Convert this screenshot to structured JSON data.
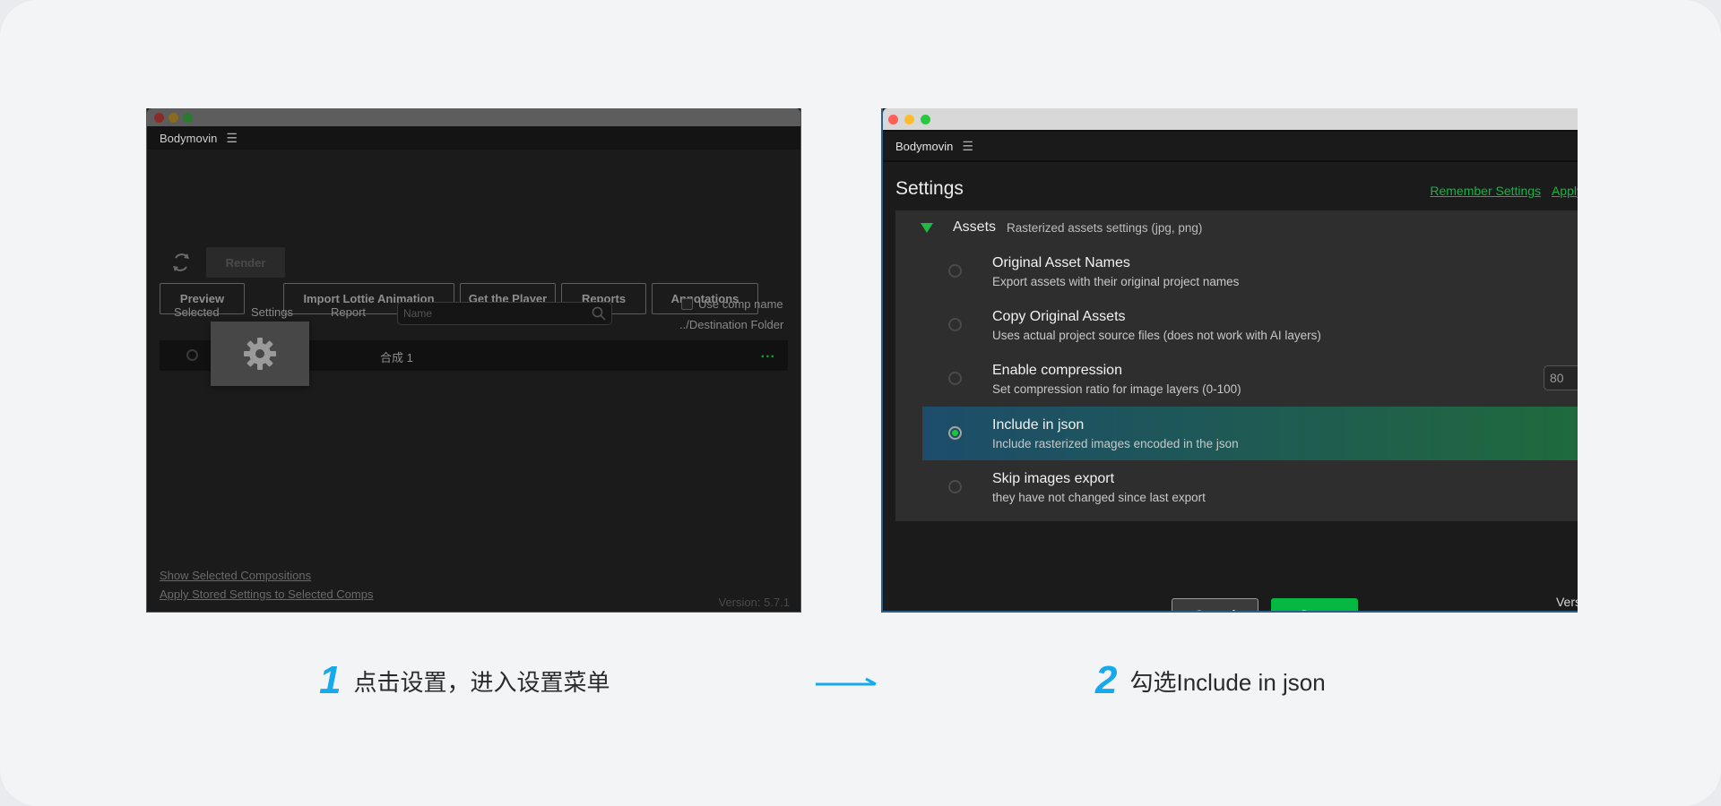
{
  "colors": {
    "accent_green": "#04b842",
    "link_green": "#11b740",
    "caption_blue": "#16a9ec"
  },
  "window1": {
    "panel_title": "Bodymovin",
    "buttons": {
      "preview": "Preview",
      "import_lottie": "Import Lottie Animation",
      "get_player": "Get the Player",
      "reports": "Reports",
      "annotations": "Annotations",
      "render": "Render"
    },
    "columns": {
      "selected": "Selected",
      "settings": "Settings",
      "report": "Report"
    },
    "search": {
      "placeholder": "Name"
    },
    "use_comp_name": "Use comp name",
    "destination_folder": "../Destination Folder",
    "composition": {
      "name": "合成 1",
      "more": "..."
    },
    "footer": {
      "show_selected": "Show Selected Compositions",
      "apply_stored": "Apply Stored Settings to Selected Comps",
      "version": "Version: 5.7.1"
    }
  },
  "window2": {
    "panel_title": "Bodymovin",
    "settings_title": "Settings",
    "links": {
      "remember": "Remember Settings",
      "apply": "Apply"
    },
    "assets": {
      "title": "Assets",
      "subtitle": "Rasterized assets settings (jpg, png)",
      "options": [
        {
          "title": "Original Asset Names",
          "desc": "Export assets with their original project names",
          "selected": false
        },
        {
          "title": "Copy Original Assets",
          "desc": "Uses actual project source files (does not work with AI layers)",
          "selected": false
        },
        {
          "title": "Enable compression",
          "desc": "Set compression ratio for image layers (0-100)",
          "selected": false
        },
        {
          "title": "Include in json",
          "desc": "Include rasterized images encoded in the json",
          "selected": true
        },
        {
          "title": "Skip images export",
          "desc": "they have not changed since last export",
          "selected": false
        }
      ],
      "compression_value": "80"
    },
    "buttons": {
      "cancel": "Cancel",
      "save": "Save"
    },
    "version": "Vers"
  },
  "captions": {
    "step1": {
      "num": "1",
      "text": "点击设置，进入设置菜单"
    },
    "step2": {
      "num": "2",
      "text": "勾选Include in json"
    }
  }
}
